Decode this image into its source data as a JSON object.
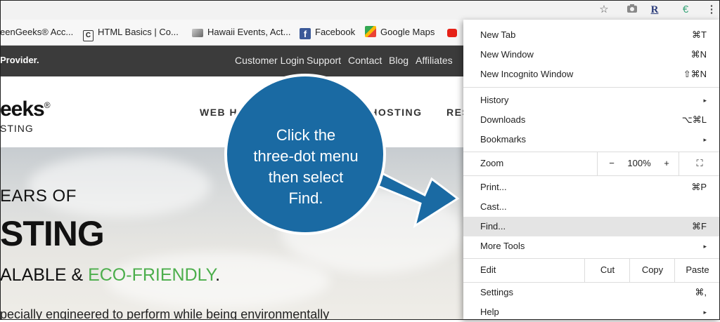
{
  "bookmarks": [
    {
      "label": "eenGeeks® Acc...",
      "color": "#4caf50"
    },
    {
      "label": "HTML Basics | Co...",
      "color": "#333333"
    },
    {
      "label": "Hawaii Events, Act...",
      "color": "#888888"
    },
    {
      "label": "Facebook",
      "color": "#3b5998"
    },
    {
      "label": "Google Maps",
      "color": "#e34133"
    }
  ],
  "toolbar": {
    "star_icon": "☆",
    "camera_icon": "camera",
    "r_icon": "R",
    "e_icon": "€",
    "menu_icon": "⋮"
  },
  "site": {
    "tagline": "Provider.",
    "top_nav": [
      "Customer Login",
      "Support",
      "Contact",
      "Blog",
      "Affiliates"
    ],
    "logo_line1": "eeks",
    "logo_reg": "®",
    "logo_line2": "STING",
    "nav_items": [
      "WEB HOS",
      "S HOSTING",
      "RES"
    ],
    "hero_line1": "EARS OF",
    "hero_line2": "STING",
    "hero_line3_prefix": "ALABLE & ",
    "hero_line3_green": "ECO-FRIENDLY",
    "hero_line3_suffix": ".",
    "hero_line4": "pecially engineered to perform while being environmentally"
  },
  "callout": {
    "lines": [
      "Click the",
      "three-dot menu",
      "then select",
      "Find."
    ],
    "color": "#1a6aa3"
  },
  "menu": {
    "items": [
      {
        "label": "New Tab",
        "shortcut": "⌘T"
      },
      {
        "label": "New Window",
        "shortcut": "⌘N"
      },
      {
        "label": "New Incognito Window",
        "shortcut": "⇧⌘N"
      },
      {
        "label": "History",
        "shortcut": "▸"
      },
      {
        "label": "Downloads",
        "shortcut": "⌥⌘L"
      },
      {
        "label": "Bookmarks",
        "shortcut": "▸"
      },
      {
        "label": "Print...",
        "shortcut": "⌘P"
      },
      {
        "label": "Cast...",
        "shortcut": ""
      },
      {
        "label": "Find...",
        "shortcut": "⌘F"
      },
      {
        "label": "More Tools",
        "shortcut": "▸"
      },
      {
        "label": "Settings",
        "shortcut": "⌘,"
      },
      {
        "label": "Help",
        "shortcut": "▸"
      }
    ],
    "zoom": {
      "label": "Zoom",
      "minus": "−",
      "value": "100%",
      "plus": "+",
      "fullscreen": "⛶"
    },
    "edit": {
      "label": "Edit",
      "cut": "Cut",
      "copy": "Copy",
      "paste": "Paste"
    }
  }
}
